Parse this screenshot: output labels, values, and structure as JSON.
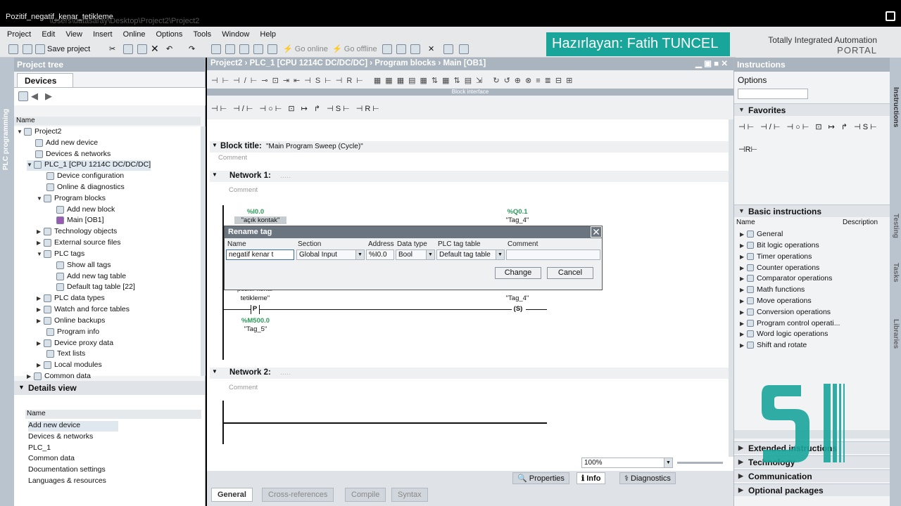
{
  "window": {
    "title": "Pozitif_negatif_kenar_tetikleme",
    "path_fragment": "\\Users\\datasaray\\Desktop\\Project2\\Project2"
  },
  "menu": [
    "Project",
    "Edit",
    "View",
    "Insert",
    "Online",
    "Options",
    "Tools",
    "Window",
    "Help"
  ],
  "toolbar": {
    "save_label": "Save project",
    "go_online": "Go online",
    "go_offline": "Go offline"
  },
  "branding": {
    "tia_line1": "Totally Integrated Automation",
    "tia_line2": "PORTAL",
    "banner": "Hazırlayan: Fatih TUNCEL",
    "accent": "#1aa59b"
  },
  "project_tree": {
    "title": "Project tree",
    "tab": "Devices",
    "name_header": "Name",
    "side_label": "PLC programming",
    "items": [
      {
        "label": "Project2"
      },
      {
        "label": "Add new device"
      },
      {
        "label": "Devices & networks"
      },
      {
        "label": "PLC_1 [CPU 1214C DC/DC/DC]"
      },
      {
        "label": "Device configuration"
      },
      {
        "label": "Online & diagnostics"
      },
      {
        "label": "Program blocks"
      },
      {
        "label": "Add new block"
      },
      {
        "label": "Main [OB1]"
      },
      {
        "label": "Technology objects"
      },
      {
        "label": "External source files"
      },
      {
        "label": "PLC tags"
      },
      {
        "label": "Show all tags"
      },
      {
        "label": "Add new tag table"
      },
      {
        "label": "Default tag table [22]"
      },
      {
        "label": "PLC data types"
      },
      {
        "label": "Watch and force tables"
      },
      {
        "label": "Online backups"
      },
      {
        "label": "Program info"
      },
      {
        "label": "Device proxy data"
      },
      {
        "label": "Text lists"
      },
      {
        "label": "Local modules"
      },
      {
        "label": "Common data"
      }
    ]
  },
  "details": {
    "title": "Details view",
    "name_header": "Name",
    "items": [
      {
        "label": "Add new device"
      },
      {
        "label": "Devices & networks"
      },
      {
        "label": "PLC_1"
      },
      {
        "label": "Common data"
      },
      {
        "label": "Documentation settings"
      },
      {
        "label": "Languages & resources"
      }
    ]
  },
  "editor": {
    "breadcrumb": [
      "Project2",
      "PLC_1 [CPU 1214C DC/DC/DC]",
      "Program blocks",
      "Main [OB1]"
    ],
    "block_interface": "Block interface",
    "block_title_label": "Block title:",
    "block_title_value": "\"Main Program Sweep (Cycle)\"",
    "comment": "Comment",
    "network1": "Network 1:",
    "network1_dots": ".....",
    "network2": "Network 2:",
    "network2_dots": ".....",
    "rung1": {
      "in_addr": "%I0.0",
      "in_name": "\"açık kontak\"",
      "out_addr": "%Q0.1",
      "out_name": "\"Tag_4\""
    },
    "rung2": {
      "in_name1": "pozitif kenar",
      "in_name2": "tetikleme\"",
      "edge_addr": "%M500.0",
      "edge_name": "\"Tag_5\"",
      "out_addr": "%Q0.1",
      "out_name": "\"Tag_4\"",
      "edge_label": "P",
      "coil_label": "S"
    },
    "zoom": "100%"
  },
  "dialog": {
    "title": "Rename tag",
    "headers": [
      "Name",
      "Section",
      "Address",
      "Data type",
      "PLC tag table",
      "Comment"
    ],
    "values": {
      "name": "negatif kenar t",
      "section": "Global Input",
      "address": "%I0.0",
      "data_type": "Bool",
      "tag_table": "Default tag table",
      "comment": ""
    },
    "change_label": "Change",
    "cancel_label": "Cancel"
  },
  "inspector_tabs": {
    "properties": "Properties",
    "info": "Info",
    "diagnostics": "Diagnostics"
  },
  "bottom_tabs": [
    "General",
    "Cross-references",
    "Compile",
    "Syntax"
  ],
  "instructions": {
    "title": "Instructions",
    "options": "Options",
    "favorites": "Favorites",
    "basic": "Basic instructions",
    "col_name": "Name",
    "col_desc": "Description",
    "items": [
      {
        "label": "General"
      },
      {
        "label": "Bit logic operations"
      },
      {
        "label": "Timer operations"
      },
      {
        "label": "Counter operations"
      },
      {
        "label": "Comparator operations"
      },
      {
        "label": "Math functions"
      },
      {
        "label": "Move operations"
      },
      {
        "label": "Conversion operations"
      },
      {
        "label": "Program control operati..."
      },
      {
        "label": "Word logic operations"
      },
      {
        "label": "Shift and rotate"
      }
    ],
    "extended": "Extended instructions",
    "technology": "Technology",
    "communication": "Communication",
    "optional": "Optional packages",
    "side_tabs": [
      "Instructions",
      "Testing",
      "Tasks",
      "Libraries"
    ]
  }
}
